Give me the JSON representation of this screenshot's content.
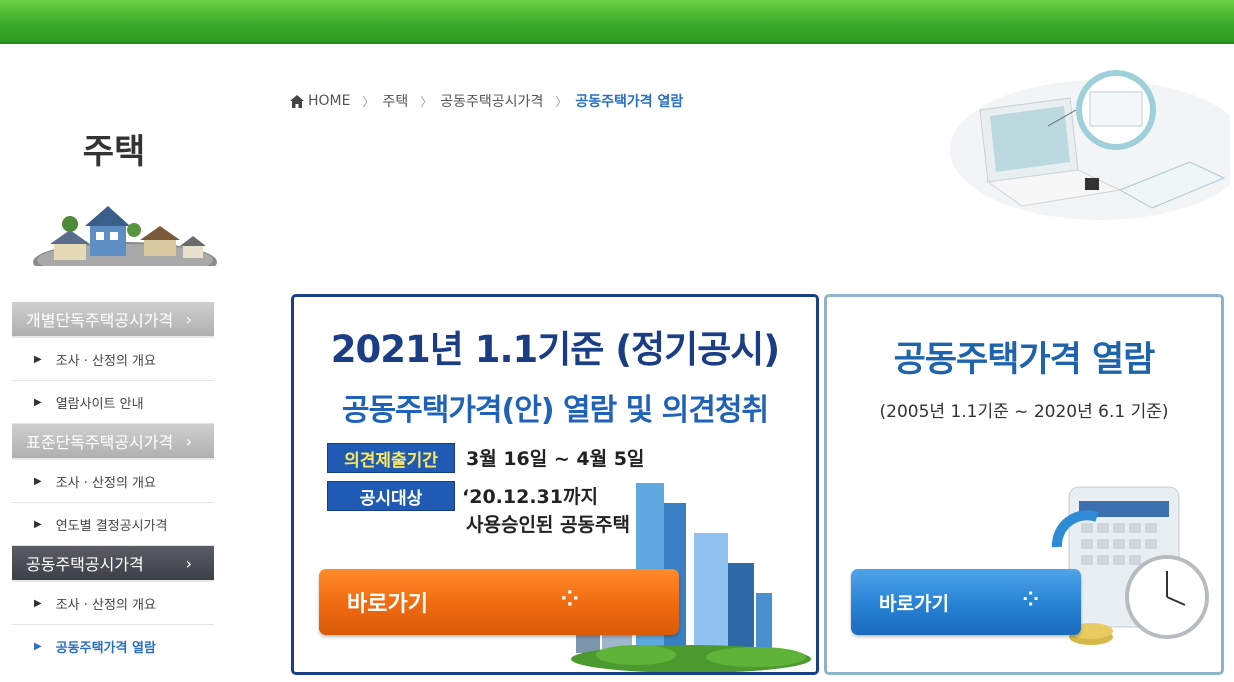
{
  "sidebar": {
    "title": "주택",
    "menu": [
      {
        "type": "header",
        "label": "개별단독주택공시가격",
        "arrow": "›",
        "active": false
      },
      {
        "type": "sub",
        "label": "조사 · 산정의 개요"
      },
      {
        "type": "sub",
        "label": "열람사이트 안내"
      },
      {
        "type": "header",
        "label": "표준단독주택공시가격",
        "arrow": "›",
        "active": false
      },
      {
        "type": "sub",
        "label": "조사 · 산정의 개요"
      },
      {
        "type": "sub",
        "label": "연도별 결정공시가격"
      },
      {
        "type": "header",
        "label": "공동주택공시가격",
        "arrow": "›",
        "active": true
      },
      {
        "type": "sub",
        "label": "조사 · 산정의 개요"
      },
      {
        "type": "sub",
        "label": "공동주택가격 열람",
        "current": true
      }
    ]
  },
  "breadcrumb": {
    "home": "HOME",
    "items": [
      "주택",
      "공동주택공시가격"
    ],
    "current": "공동주택가격 열람"
  },
  "banner_left": {
    "title1": "2021년 1.1기준 (정기공시)",
    "title2": "공동주택가격(안) 열람 및 의견청취",
    "tag1": "의견제출기간",
    "info1": "3월 16일 ~ 4월 5일",
    "tag2": "공시대상",
    "info2": "‘20.12.31까지",
    "info3": "사용승인된 공동주택",
    "button": "바로가기"
  },
  "banner_right": {
    "title": "공동주택가격 열람",
    "subtitle": "(2005년 1.1기준 ~ 2020년 6.1 기준)",
    "button": "바로가기"
  },
  "icons": {
    "home": "home-icon",
    "breadcrumb_sep": "chevron-right-icon",
    "button_arrow": "arrow-right-icon"
  },
  "colors": {
    "top_bar": "#3aa82a",
    "accent_blue": "#1e63ad",
    "orange_button": "#f06a10",
    "blue_button": "#2781d4"
  }
}
